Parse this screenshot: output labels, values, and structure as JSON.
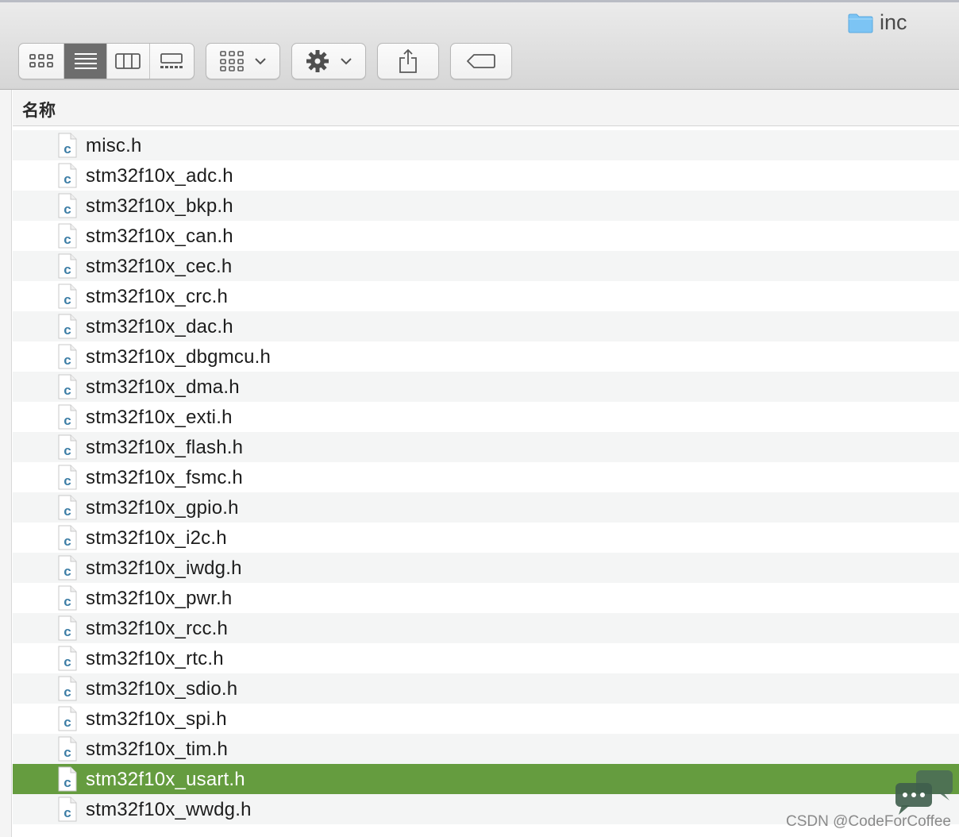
{
  "window": {
    "title": "inc",
    "title_icon": "folder-icon"
  },
  "toolbar": {
    "view_modes": [
      {
        "name": "icon-view",
        "icon": "grid-icon",
        "active": false
      },
      {
        "name": "list-view",
        "icon": "list-icon",
        "active": true
      },
      {
        "name": "column-view",
        "icon": "columns-icon",
        "active": false
      },
      {
        "name": "gallery-view",
        "icon": "gallery-icon",
        "active": false
      }
    ],
    "group_button_icon": "group-grid-icon",
    "action_button_icon": "gear-icon",
    "share_button_icon": "share-icon",
    "tag_button_icon": "tag-icon"
  },
  "list": {
    "column_header": "名称",
    "selected_color": "#659c3f",
    "file_icon": "c-source-file-icon",
    "files": [
      {
        "name": "misc.h",
        "selected": false
      },
      {
        "name": "stm32f10x_adc.h",
        "selected": false
      },
      {
        "name": "stm32f10x_bkp.h",
        "selected": false
      },
      {
        "name": "stm32f10x_can.h",
        "selected": false
      },
      {
        "name": "stm32f10x_cec.h",
        "selected": false
      },
      {
        "name": "stm32f10x_crc.h",
        "selected": false
      },
      {
        "name": "stm32f10x_dac.h",
        "selected": false
      },
      {
        "name": "stm32f10x_dbgmcu.h",
        "selected": false
      },
      {
        "name": "stm32f10x_dma.h",
        "selected": false
      },
      {
        "name": "stm32f10x_exti.h",
        "selected": false
      },
      {
        "name": "stm32f10x_flash.h",
        "selected": false
      },
      {
        "name": "stm32f10x_fsmc.h",
        "selected": false
      },
      {
        "name": "stm32f10x_gpio.h",
        "selected": false
      },
      {
        "name": "stm32f10x_i2c.h",
        "selected": false
      },
      {
        "name": "stm32f10x_iwdg.h",
        "selected": false
      },
      {
        "name": "stm32f10x_pwr.h",
        "selected": false
      },
      {
        "name": "stm32f10x_rcc.h",
        "selected": false
      },
      {
        "name": "stm32f10x_rtc.h",
        "selected": false
      },
      {
        "name": "stm32f10x_sdio.h",
        "selected": false
      },
      {
        "name": "stm32f10x_spi.h",
        "selected": false
      },
      {
        "name": "stm32f10x_tim.h",
        "selected": false
      },
      {
        "name": "stm32f10x_usart.h",
        "selected": true
      },
      {
        "name": "stm32f10x_wwdg.h",
        "selected": false
      }
    ]
  },
  "watermark": {
    "text": "CSDN @CodeForCoffee"
  }
}
